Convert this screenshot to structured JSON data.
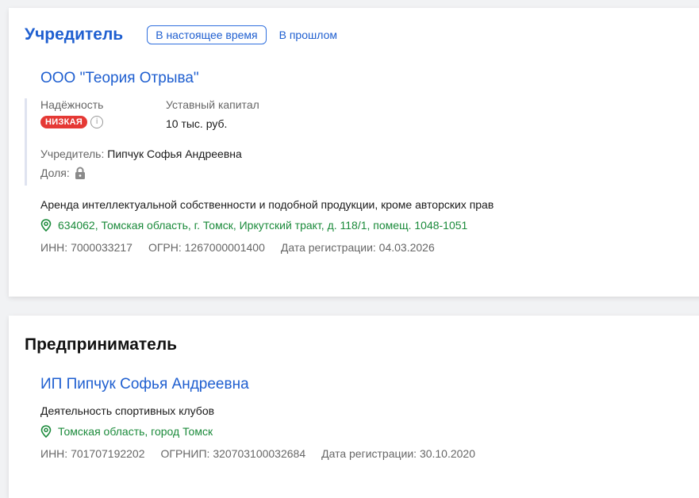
{
  "founder_section": {
    "title": "Учредитель",
    "tabs": [
      "В настоящее время",
      "В прошлом"
    ],
    "company": {
      "name": "ООО \"Теория Отрыва\"",
      "reliability_label": "Надёжность",
      "reliability_badge": "НИЗКАЯ",
      "capital_label": "Уставный капитал",
      "capital_value": "10 тыс. руб.",
      "founder_label": "Учредитель:",
      "founder_name": "Пипчук Софья Андреевна",
      "share_label": "Доля:",
      "activity": "Аренда интеллектуальной собственности и подобной продукции, кроме авторских прав",
      "address": "634062, Томская область, г. Томск, Иркутский тракт, д. 118/1, помещ. 1048-1051",
      "inn": "ИНН: 7000033217",
      "ogrn": "ОГРН: 1267000001400",
      "reg_date": "Дата регистрации: 04.03.2026"
    }
  },
  "entrepreneur_section": {
    "title": "Предприниматель",
    "name": "ИП Пипчук Софья Андреевна",
    "activity": "Деятельность спортивных клубов",
    "address": "Томская область, город Томск",
    "inn": "ИНН: 701707192202",
    "ogrnip": "ОГРНИП: 320703100032684",
    "reg_date": "Дата регистрации: 30.10.2020"
  },
  "colors": {
    "link_blue": "#1f5fd0",
    "address_green": "#1a8a3a",
    "badge_red": "#e53935"
  },
  "icons": [
    "info-icon",
    "lock-icon",
    "location-pin-icon"
  ]
}
